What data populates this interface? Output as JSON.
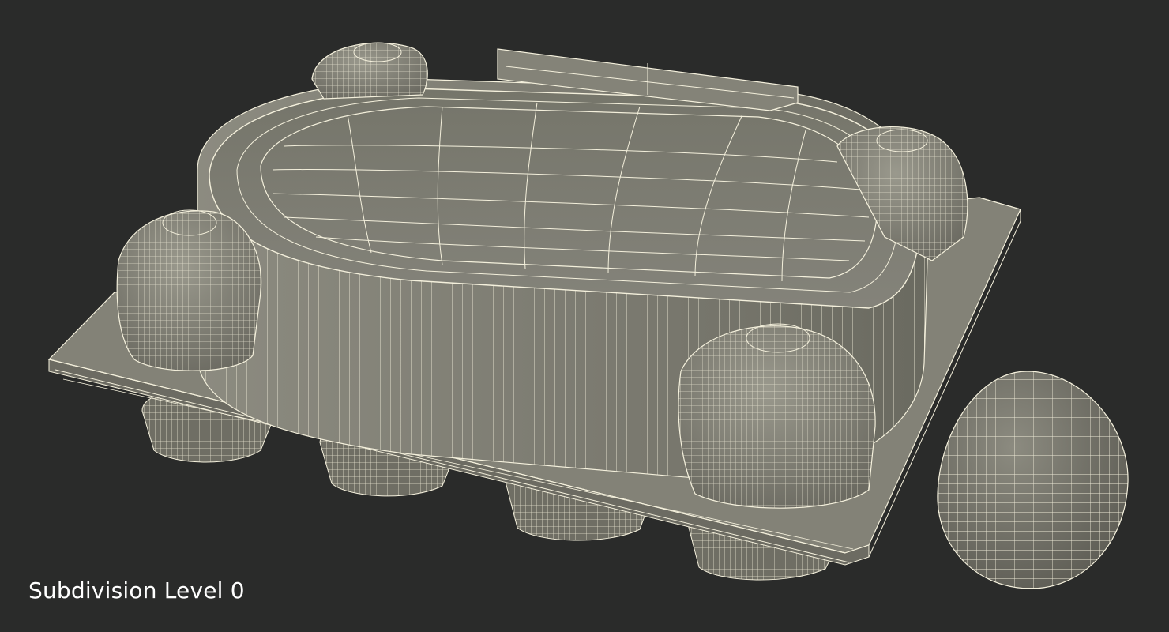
{
  "viewport": {
    "background": "#2a2b2a",
    "caption": "Subdivision Level 0"
  },
  "render": {
    "style": "wireframe-on-shaded",
    "surface_color": "#7c7b6e",
    "wire_color": "#f4f0dc"
  },
  "scene": {
    "objects": [
      "egg-carton-closed",
      "egg"
    ]
  }
}
